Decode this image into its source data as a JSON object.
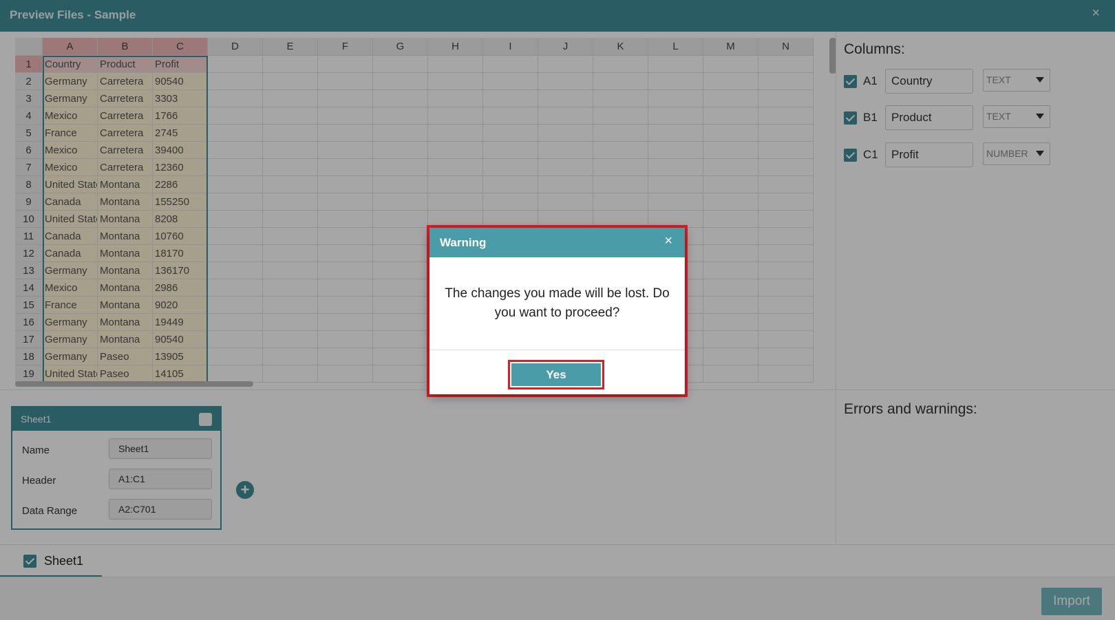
{
  "window": {
    "title": "Preview Files - Sample",
    "close_glyph": "×"
  },
  "grid": {
    "col_headers": [
      "A",
      "B",
      "C",
      "D",
      "E",
      "F",
      "G",
      "H",
      "I",
      "J",
      "K",
      "L",
      "M",
      "N"
    ],
    "rows": [
      {
        "n": "1",
        "a": "Country",
        "b": "Product",
        "c": "Profit"
      },
      {
        "n": "2",
        "a": "Germany",
        "b": "Carretera",
        "c": "90540"
      },
      {
        "n": "3",
        "a": "Germany",
        "b": "Carretera",
        "c": "3303"
      },
      {
        "n": "4",
        "a": "Mexico",
        "b": "Carretera",
        "c": "1766"
      },
      {
        "n": "5",
        "a": "France",
        "b": "Carretera",
        "c": "2745"
      },
      {
        "n": "6",
        "a": "Mexico",
        "b": "Carretera",
        "c": "39400"
      },
      {
        "n": "7",
        "a": "Mexico",
        "b": "Carretera",
        "c": "12360"
      },
      {
        "n": "8",
        "a": "United States",
        "b": "Montana",
        "c": "2286"
      },
      {
        "n": "9",
        "a": "Canada",
        "b": "Montana",
        "c": "155250"
      },
      {
        "n": "10",
        "a": "United States",
        "b": "Montana",
        "c": "8208"
      },
      {
        "n": "11",
        "a": "Canada",
        "b": "Montana",
        "c": "10760"
      },
      {
        "n": "12",
        "a": "Canada",
        "b": "Montana",
        "c": "18170"
      },
      {
        "n": "13",
        "a": "Germany",
        "b": "Montana",
        "c": "136170"
      },
      {
        "n": "14",
        "a": "Mexico",
        "b": "Montana",
        "c": "2986"
      },
      {
        "n": "15",
        "a": "France",
        "b": "Montana",
        "c": "9020"
      },
      {
        "n": "16",
        "a": "Germany",
        "b": "Montana",
        "c": "19449"
      },
      {
        "n": "17",
        "a": "Germany",
        "b": "Montana",
        "c": "90540"
      },
      {
        "n": "18",
        "a": "Germany",
        "b": "Paseo",
        "c": "13905"
      },
      {
        "n": "19",
        "a": "United States",
        "b": "Paseo",
        "c": "14105"
      }
    ]
  },
  "columns_panel": {
    "title": "Columns:",
    "items": [
      {
        "ref": "A1",
        "name": "Country",
        "type": "TEXT"
      },
      {
        "ref": "B1",
        "name": "Product",
        "type": "TEXT"
      },
      {
        "ref": "C1",
        "name": "Profit",
        "type": "NUMBER"
      }
    ]
  },
  "errors_panel": {
    "title": "Errors and warnings:"
  },
  "sheet_card": {
    "title": "Sheet1",
    "name_label": "Name",
    "name_value": "Sheet1",
    "header_label": "Header",
    "header_value": "A1:C1",
    "range_label": "Data Range",
    "range_value": "A2:C701",
    "add_glyph": "+"
  },
  "tabs": [
    {
      "label": "Sheet1"
    }
  ],
  "footer": {
    "import_label": "Import"
  },
  "dialog": {
    "title": "Warning",
    "close_glyph": "×",
    "message": "The changes you made will be lost. Do you want to proceed?",
    "yes_label": "Yes"
  },
  "colors": {
    "accent": "#3f8f99",
    "highlight": "#e01b24"
  }
}
